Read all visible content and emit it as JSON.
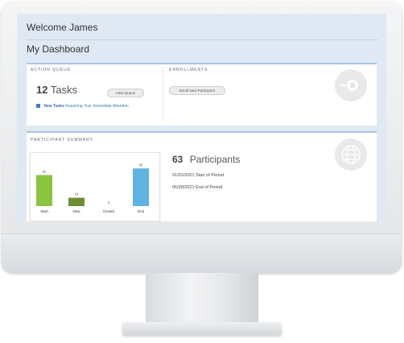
{
  "dashboard": {
    "welcome": "Welcome James",
    "title": "My Dashboard"
  },
  "action_queue": {
    "label": "ACTION QUEUE",
    "count": "12",
    "count_label": "Tasks",
    "view_button": "View Queue",
    "new_tasks_bold": "New Tasks",
    "new_tasks_rest": "Requiring Your Immediate Attention"
  },
  "enrollments": {
    "label": "ENROLLMENTS",
    "button": "Enroll New Participant"
  },
  "participant_summary": {
    "label": "PARTICIPANT SUMMARY",
    "count": "63",
    "count_label": "Participants",
    "start_line": "01/01/2021 Start of Period",
    "end_line": "06/30/2021 End of Period"
  },
  "colors": {
    "bar_green": "#8bc540",
    "bar_olive": "#6a8f35",
    "bar_blue": "#5fb3e0",
    "accent_blue": "#4a78b8"
  },
  "chart_data": {
    "type": "bar",
    "categories": [
      "Start",
      "New",
      "Closed",
      "End"
    ],
    "values": [
      52,
      14,
      0,
      63
    ],
    "data_labels": [
      "52",
      "14",
      "0",
      "63"
    ],
    "colors": [
      "#8bc540",
      "#6a8f35",
      "#8bc540",
      "#5fb3e0"
    ],
    "ylim": [
      0,
      70
    ],
    "grid": false
  }
}
